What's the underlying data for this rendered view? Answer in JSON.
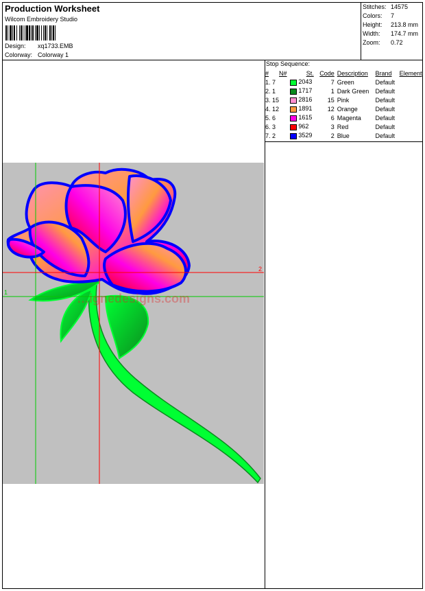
{
  "header": {
    "title": "Production Worksheet",
    "software": "Wilcom Embroidery Studio",
    "design_label": "Design:",
    "design_value": "xq1733.EMB",
    "colorway_label": "Colorway:",
    "colorway_value": "Colorway 1"
  },
  "stats": [
    {
      "label": "Stitches:",
      "value": "14575"
    },
    {
      "label": "Colors:",
      "value": "7"
    },
    {
      "label": "Height:",
      "value": "213.8 mm"
    },
    {
      "label": "Width:",
      "value": "174.7 mm"
    },
    {
      "label": "Zoom:",
      "value": "0.72"
    }
  ],
  "stop_sequence": {
    "title": "Stop Sequence:",
    "columns": [
      "#",
      "N#",
      "St.",
      "Code",
      "Description",
      "Brand",
      "Element"
    ],
    "rows": [
      {
        "num": "1. 7",
        "needle": "",
        "color": "#00ff33",
        "stitches": "2043",
        "code": "7",
        "description": "Green",
        "brand": "Default",
        "element": ""
      },
      {
        "num": "2. 1",
        "needle": "",
        "color": "#0b8a1e",
        "stitches": "1717",
        "code": "1",
        "description": "Dark Green",
        "brand": "Default",
        "element": ""
      },
      {
        "num": "3. 15",
        "needle": "",
        "color": "#ff8fd0",
        "stitches": "2816",
        "code": "15",
        "description": "Pink",
        "brand": "Default",
        "element": ""
      },
      {
        "num": "4. 12",
        "needle": "",
        "color": "#ff9a40",
        "stitches": "1891",
        "code": "12",
        "description": "Orange",
        "brand": "Default",
        "element": ""
      },
      {
        "num": "5. 6",
        "needle": "",
        "color": "#ff00e6",
        "stitches": "1615",
        "code": "6",
        "description": "Magenta",
        "brand": "Default",
        "element": ""
      },
      {
        "num": "6. 3",
        "needle": "",
        "color": "#ff0000",
        "stitches": "962",
        "code": "3",
        "description": "Red",
        "brand": "Default",
        "element": ""
      },
      {
        "num": "7. 2",
        "needle": "",
        "color": "#0000ff",
        "stitches": "3529",
        "code": "2",
        "description": "Blue",
        "brand": "Default",
        "element": ""
      }
    ]
  },
  "preview": {
    "background": "#c0c0c0",
    "marker_1": "1",
    "marker_2": "2",
    "watermark": "…ignedesigns.com"
  }
}
